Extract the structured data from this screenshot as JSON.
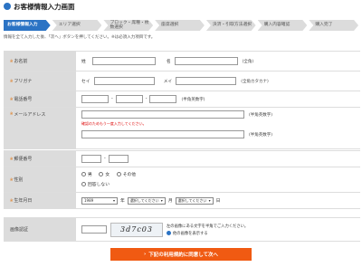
{
  "header": {
    "title": "お客様情報入力画面"
  },
  "steps": [
    {
      "label": "お客様情報入力",
      "active": true
    },
    {
      "label": "エリア選択"
    },
    {
      "label": "ブロック・席種・枚数選択"
    },
    {
      "label": "座席選択"
    },
    {
      "label": "決済・引取方法選択"
    },
    {
      "label": "購入内容確認"
    },
    {
      "label": "購入完了"
    }
  ],
  "intro": "情報を全て入力した後、「次へ」ボタンを押してください。※は必須入力項目です。",
  "mark": "※",
  "name_row": {
    "label": "お名前",
    "sei": "姓",
    "mei": "名",
    "note": "(全角)"
  },
  "kana_row": {
    "label": "フリガナ",
    "sei": "セイ",
    "mei": "メイ",
    "note": "(全角カタカナ)"
  },
  "phone_row": {
    "label": "電話番号",
    "dash": "-",
    "note": "(半角英数字)"
  },
  "email_row": {
    "label": "メールアドレス",
    "note1": "(半角英数字)",
    "error": "確認のためもう一度入力してください。",
    "note2": "(半角英数字)"
  },
  "zip_row": {
    "label": "郵便番号",
    "dash": "-"
  },
  "gender_row": {
    "label": "性別",
    "options": [
      "男",
      "女",
      "その他"
    ],
    "option4": "回答しない"
  },
  "birth_row": {
    "label": "生年月日",
    "year": "1989",
    "year_unit": "年",
    "month": "選択してください",
    "month_unit": "月",
    "day": "選択してください",
    "day_unit": "日"
  },
  "captcha_row": {
    "label": "画像認証",
    "captcha_text": "3d7c03",
    "hint": "左の画像にある文字を半角でご入力ください。",
    "alt_option": "他の画像を表示する"
  },
  "submit": {
    "label": "下記の利用規約に同意して次へ"
  }
}
